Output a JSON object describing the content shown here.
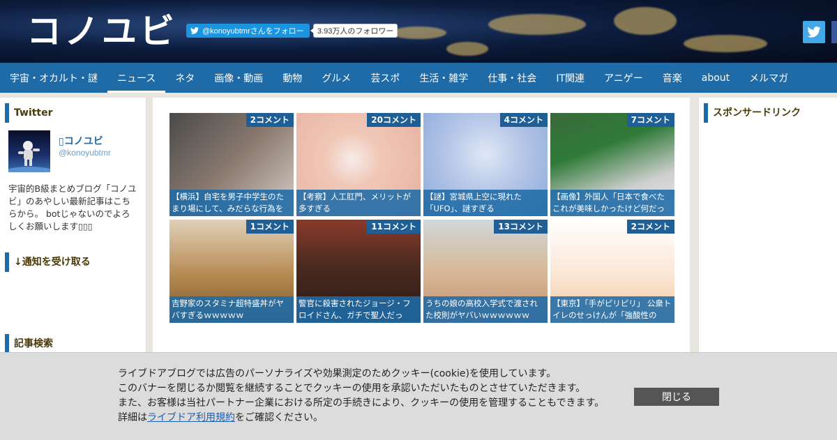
{
  "header": {
    "logo_text": "コノユビ",
    "follow_label": "@konoyubtmrさんをフォロー",
    "follower_count": "3.93万人のフォロワー"
  },
  "nav": {
    "items": [
      {
        "label": "宇宙・オカルト・謎"
      },
      {
        "label": "ニュース",
        "active": true
      },
      {
        "label": "ネタ"
      },
      {
        "label": "画像・動画"
      },
      {
        "label": "動物"
      },
      {
        "label": "グルメ"
      },
      {
        "label": "芸スポ"
      },
      {
        "label": "生活・雑学"
      },
      {
        "label": "仕事・社会"
      },
      {
        "label": "IT関連"
      },
      {
        "label": "アニゲー"
      },
      {
        "label": "音楽"
      },
      {
        "label": "about"
      },
      {
        "label": "メルマガ"
      }
    ]
  },
  "sidebar": {
    "twitter_heading": "Twitter",
    "profile_name": "▯コノユビ",
    "profile_handle": "@konoyubtmr",
    "profile_desc": "宇宙的B級まとめブログ「コノユビ」のあやしい最新記事はこちらから。 botじゃないのでよろしくお願いします▯▯▯",
    "notify_heading": "↓通知を受け取る",
    "search_heading": "記事検索"
  },
  "right": {
    "heading": "スポンサードリンク"
  },
  "articles": [
    {
      "comments": "2コメント",
      "title": "【横浜】自宅を男子中学生のたまり場にして、みだらな行為を"
    },
    {
      "comments": "20コメント",
      "title": "【考察】人工肛門、メリットが多すぎる"
    },
    {
      "comments": "4コメント",
      "title": "【謎】宮城県上空に現れた「UFO」、謎すぎる"
    },
    {
      "comments": "7コメント",
      "title": "【画像】外国人「日本で食べたこれが美味しかったけど何だっ"
    },
    {
      "comments": "1コメント",
      "title": "吉野家のスタミナ超特盛丼がヤバすぎるｗｗｗｗｗ"
    },
    {
      "comments": "11コメント",
      "title": "警官に殺害されたジョージ・フロイドさん、ガチで聖人だっ"
    },
    {
      "comments": "13コメント",
      "title": "うちの娘の高校入学式で渡された校則がヤバいｗｗｗｗｗｗ"
    },
    {
      "comments": "2コメント",
      "title": "【東京】「手がピリピリ」 公衆トイレのせっけんが「強酸性の"
    }
  ],
  "cookie_banner": {
    "line1": "ライブドアブログでは広告のパーソナライズや効果測定のためクッキー(cookie)を使用しています。",
    "line2": "このバナーを閉じるか閲覧を継続することでクッキーの使用を承認いただいたものとさせていただきます。",
    "line3": "また、お客様は当社パートナー企業における所定の手続きにより、クッキーの使用を管理することもできます。",
    "line4_pre": "詳細は",
    "line4_link": "ライブドア利用規約",
    "line4_post": "をご確認ください。",
    "close_label": "閉じる"
  }
}
